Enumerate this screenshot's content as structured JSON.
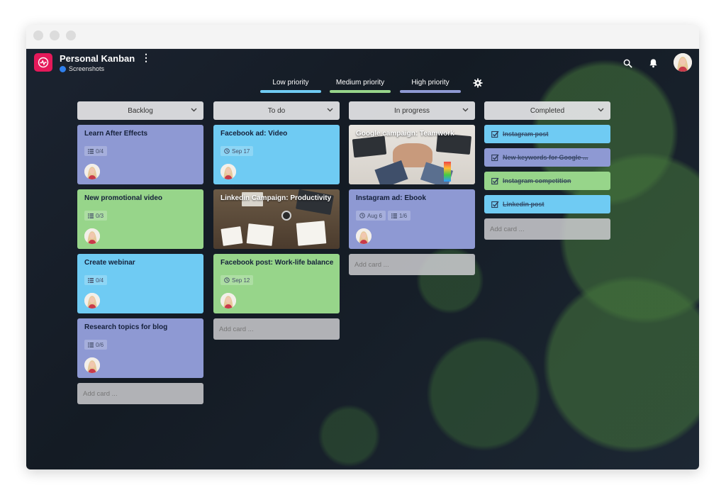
{
  "board": {
    "title": "Personal Kanban",
    "workspace": "Screenshots"
  },
  "header": {
    "icons": [
      "search-icon",
      "bell-icon",
      "avatar"
    ]
  },
  "priorities": [
    {
      "label": "Low priority",
      "color": "#6fcbf3"
    },
    {
      "label": "Medium priority",
      "color": "#97d58a"
    },
    {
      "label": "High priority",
      "color": "#8e99d3"
    }
  ],
  "colors": {
    "purple": "#8e99d3",
    "green": "#97d58a",
    "blue": "#6fcbf3",
    "logo": "#e5195a"
  },
  "columns": [
    {
      "name": "Backlog",
      "add_label": "Add card ...",
      "cards": [
        {
          "title": "Learn After Effects",
          "color": "purple",
          "badge": "0/4"
        },
        {
          "title": "New promotional video",
          "color": "green",
          "badge": "0/3"
        },
        {
          "title": "Create webinar",
          "color": "blue",
          "badge": "0/4"
        },
        {
          "title": "Research topics for blog",
          "color": "purple",
          "badge": "0/6"
        }
      ]
    },
    {
      "name": "To do",
      "add_label": "Add card ...",
      "cards": [
        {
          "title": "Facebook ad: Video",
          "color": "blue",
          "date": "Sep 17"
        },
        {
          "title": "Linkedin Campaign: Productivity",
          "color": "photo"
        },
        {
          "title": "Facebook post: Work-life balance",
          "color": "green",
          "date": "Sep 12"
        }
      ]
    },
    {
      "name": "In progress",
      "add_label": "Add card ...",
      "cards": [
        {
          "title": "Google campaign: Teamwork",
          "color": "photo"
        },
        {
          "title": "Instagram ad: Ebook",
          "color": "purple",
          "date": "Aug 6",
          "badge": "1/6"
        }
      ]
    },
    {
      "name": "Completed",
      "add_label": "Add card ...",
      "cards": [
        {
          "title": "Instagram post",
          "color": "blue"
        },
        {
          "title": "New keywords for Google ...",
          "color": "purple"
        },
        {
          "title": "Instagram competition",
          "color": "green"
        },
        {
          "title": "Linkedin post",
          "color": "blue"
        }
      ]
    }
  ]
}
